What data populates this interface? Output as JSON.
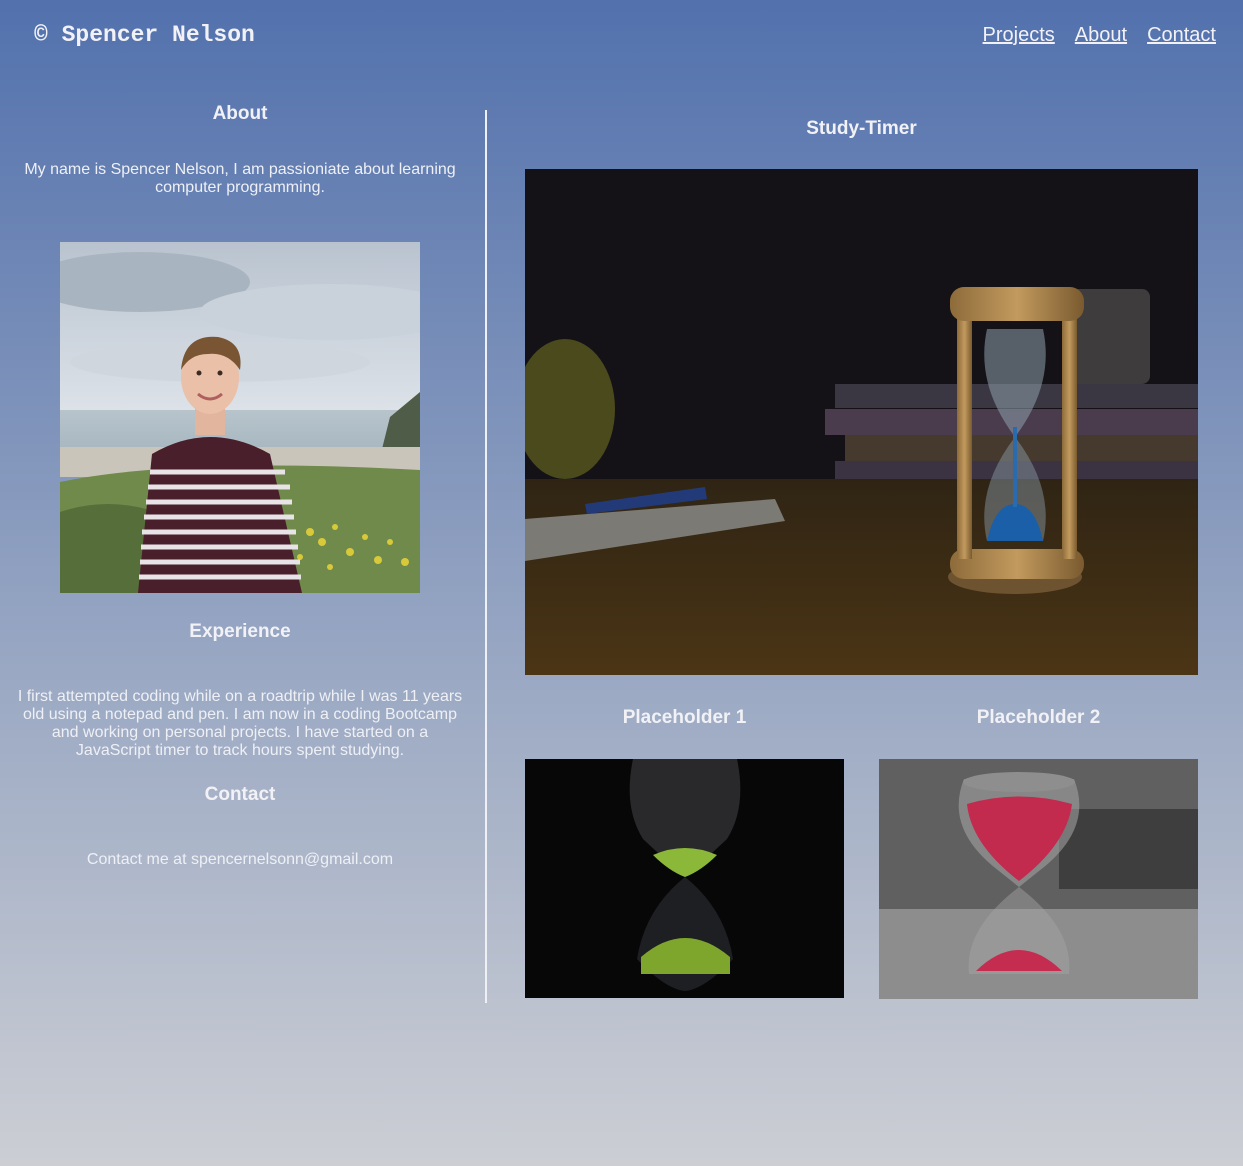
{
  "header": {
    "brand": "© Spencer Nelson",
    "nav": [
      "Projects",
      "About",
      "Contact"
    ]
  },
  "about": {
    "heading": "About",
    "text": "My name is Spencer Nelson, I am passioniate about learning computer programming."
  },
  "experience": {
    "heading": "Experience",
    "text": "I first attempted coding while on a roadtrip while I was 11 years old using a notepad and pen. I am now in a coding Bootcamp and working on personal projects. I have started on a JavaScript timer to track hours spent studying."
  },
  "contact": {
    "heading": "Contact",
    "text": "Contact me at spencernelsonn@gmail.com"
  },
  "projects": {
    "featured_title": "Study-Timer",
    "placeholder1_title": "Placeholder 1",
    "placeholder2_title": "Placeholder 2"
  },
  "colors": {
    "gradient_top": "#5271ad",
    "gradient_bottom": "#ccced4",
    "text": "#f2f2f6"
  }
}
